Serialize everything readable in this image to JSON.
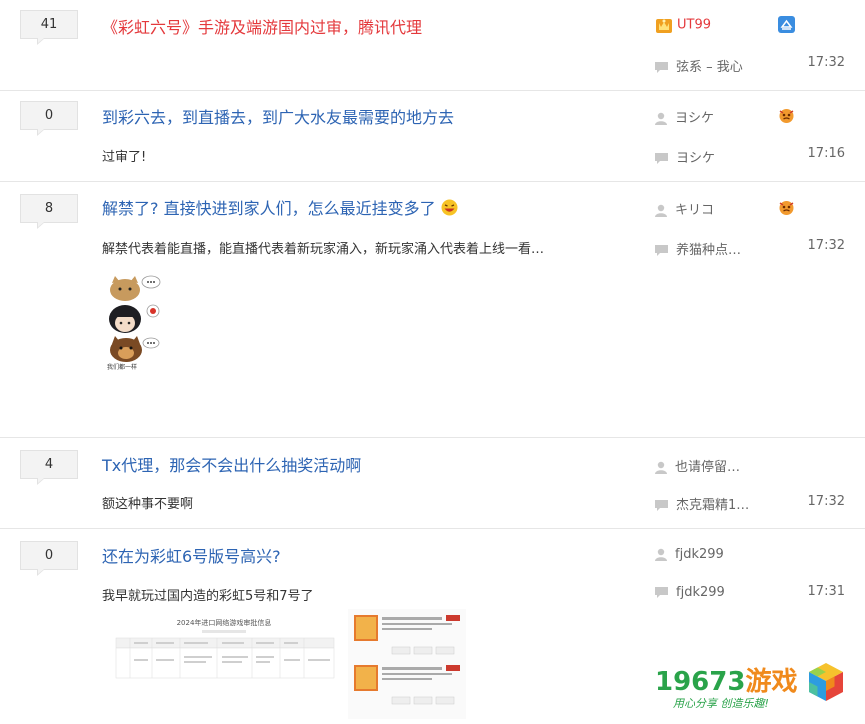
{
  "threads": [
    {
      "count": "41",
      "title": "《彩虹六号》手游及端游国内过审，腾讯代理",
      "author": "UT99",
      "excerpt": "",
      "last_reply": "弦系 – 我心",
      "time": "17:32"
    },
    {
      "count": "0",
      "title": "到彩六去，到直播去，到广大水友最需要的地方去",
      "author": "ヨシケ",
      "excerpt": "过审了!",
      "last_reply": "ヨシケ",
      "time": "17:16"
    },
    {
      "count": "8",
      "title": "解禁了? 直接快进到家人们，怎么最近挂变多了",
      "author": "キリコ",
      "excerpt": "解禁代表着能直播，能直播代表着新玩家涌入，新玩家涌入代表着上线一看…",
      "last_reply": "养猫种点…",
      "time": "17:32",
      "sticker_caption": "我们都一样"
    },
    {
      "count": "4",
      "title": "Tx代理，那会不会出什么抽奖活动啊",
      "author": "也请停留…",
      "excerpt": "额这种事不要啊",
      "last_reply": "杰克霜精1…",
      "time": "17:32"
    },
    {
      "count": "0",
      "title": "还在为彩虹6号版号高兴?",
      "author": "fjdk299",
      "excerpt": "我早就玩过国内造的彩虹5号和7号了",
      "last_reply": "fjdk299",
      "time": "17:31",
      "doc_title": "2024年进口网络游戏审批信息"
    }
  ],
  "watermark": {
    "number": "19673",
    "cn": "游戏",
    "slogan": "用心分享  创造乐趣!"
  },
  "colors": {
    "link": "#2d64b3",
    "highlight": "#e4393c",
    "muted": "#666666"
  }
}
